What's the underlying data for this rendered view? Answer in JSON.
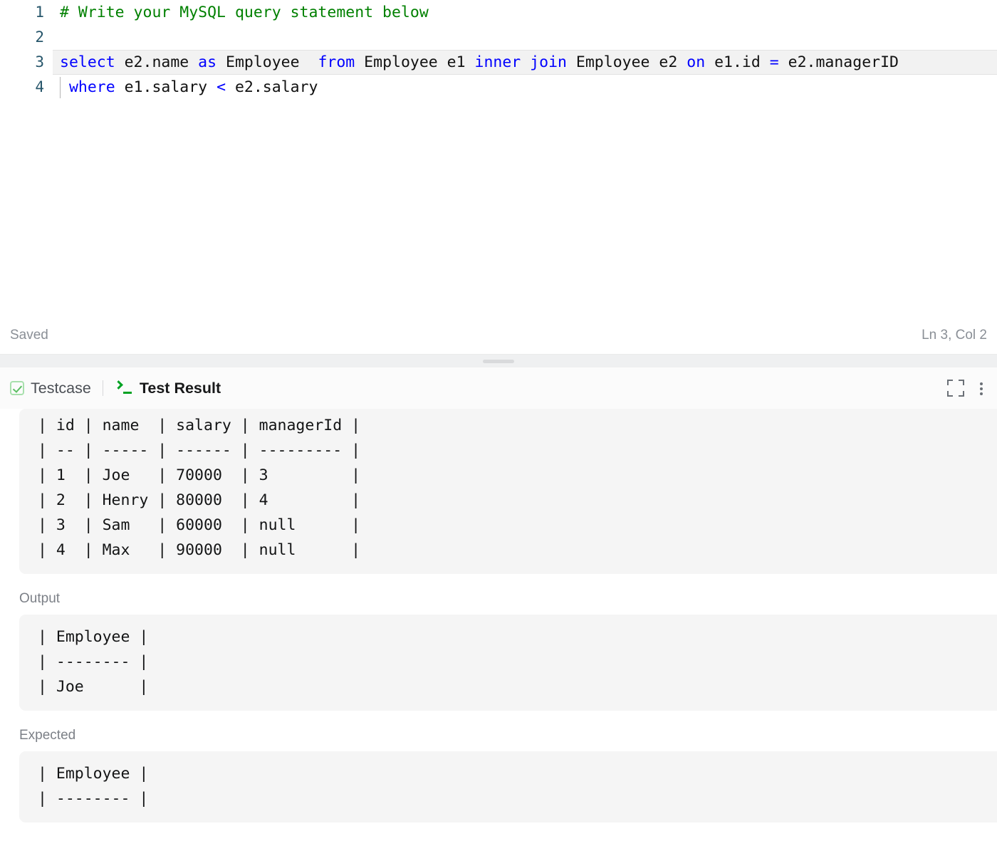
{
  "editor": {
    "lines": [
      {
        "number": "1",
        "active": false,
        "indent_guide": false,
        "tokens": [
          {
            "t": "# Write your MySQL query statement below",
            "c": "cmt"
          }
        ]
      },
      {
        "number": "2",
        "active": false,
        "indent_guide": false,
        "tokens": []
      },
      {
        "number": "3",
        "active": true,
        "indent_guide": false,
        "tokens": [
          {
            "t": "select",
            "c": "kw"
          },
          {
            "t": " e2.name ",
            "c": "pln"
          },
          {
            "t": "as",
            "c": "kw"
          },
          {
            "t": " Employee  ",
            "c": "pln"
          },
          {
            "t": "from",
            "c": "kw"
          },
          {
            "t": " Employee e1 ",
            "c": "pln"
          },
          {
            "t": "inner join",
            "c": "kw"
          },
          {
            "t": " Employee e2 ",
            "c": "pln"
          },
          {
            "t": "on",
            "c": "kw"
          },
          {
            "t": " e1.id ",
            "c": "pln"
          },
          {
            "t": "=",
            "c": "op"
          },
          {
            "t": " e2.managerID",
            "c": "pln"
          }
        ]
      },
      {
        "number": "4",
        "active": false,
        "indent_guide": true,
        "tokens": [
          {
            "t": " ",
            "c": "pln"
          },
          {
            "t": "where",
            "c": "kw"
          },
          {
            "t": " e1.salary ",
            "c": "pln"
          },
          {
            "t": "<",
            "c": "op"
          },
          {
            "t": " e2.salary",
            "c": "pln"
          }
        ]
      }
    ],
    "status": {
      "saved_label": "Saved",
      "cursor_position": "Ln 3, Col 2"
    }
  },
  "result_panel": {
    "tabs": [
      {
        "label": "Testcase",
        "icon": "checkbox-icon",
        "active": false
      },
      {
        "label": "Test Result",
        "icon": "terminal-icon",
        "active": true
      }
    ],
    "actions": [
      {
        "icon": "expand-fullscreen-icon"
      },
      {
        "icon": "more-options-icon"
      }
    ],
    "testcase_table": "| id | name  | salary | managerId |\n| -- | ----- | ------ | --------- |\n| 1  | Joe   | 70000  | 3         |\n| 2  | Henry | 80000  | 4         |\n| 3  | Sam   | 60000  | null      |\n| 4  | Max   | 90000  | null      |",
    "output": {
      "label": "Output",
      "content": "| Employee |\n| -------- |\n| Joe      |"
    },
    "expected": {
      "label": "Expected",
      "content": "| Employee |\n| -------- |"
    }
  }
}
